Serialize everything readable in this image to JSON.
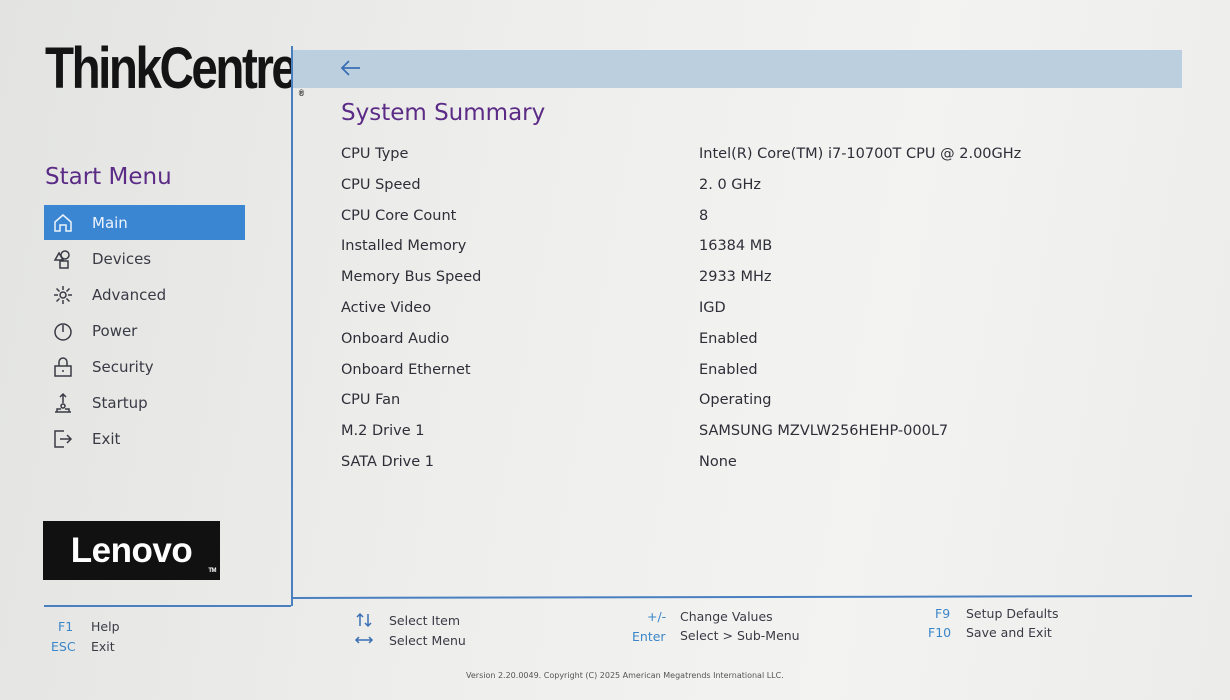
{
  "brand": {
    "name": "ThinkCentre",
    "trademark": "®"
  },
  "sidebar": {
    "title": "Start Menu",
    "items": [
      {
        "label": "Main",
        "icon": "home-icon",
        "active": true
      },
      {
        "label": "Devices",
        "icon": "devices-icon",
        "active": false
      },
      {
        "label": "Advanced",
        "icon": "advanced-icon",
        "active": false
      },
      {
        "label": "Power",
        "icon": "power-icon",
        "active": false
      },
      {
        "label": "Security",
        "icon": "lock-icon",
        "active": false
      },
      {
        "label": "Startup",
        "icon": "startup-icon",
        "active": false
      },
      {
        "label": "Exit",
        "icon": "exit-icon",
        "active": false
      }
    ]
  },
  "logo": {
    "name": "Lenovo",
    "trademark": "TM"
  },
  "main": {
    "title": "System Summary",
    "rows": [
      {
        "label": "CPU Type",
        "value": "Intel(R) Core(TM) i7-10700T CPU @ 2.00GHz"
      },
      {
        "label": "CPU Speed",
        "value": "2. 0 GHz"
      },
      {
        "label": "CPU Core Count",
        "value": "8"
      },
      {
        "label": "Installed Memory",
        "value": "16384 MB"
      },
      {
        "label": "Memory Bus Speed",
        "value": "2933 MHz"
      },
      {
        "label": "Active Video",
        "value": "IGD"
      },
      {
        "label": "Onboard Audio",
        "value": "Enabled"
      },
      {
        "label": "Onboard Ethernet",
        "value": "Enabled"
      },
      {
        "label": "CPU Fan",
        "value": "Operating"
      },
      {
        "label": "M.2 Drive 1",
        "value": "SAMSUNG MZVLW256HEHP-000L7"
      },
      {
        "label": "SATA Drive 1",
        "value": "None"
      }
    ]
  },
  "footer": {
    "f1_key": "F1",
    "f1_desc": "Help",
    "esc_key": "ESC",
    "esc_desc": "Exit",
    "select_item": "Select Item",
    "select_menu": "Select Menu",
    "plusminus_key": "+/-",
    "plusminus_desc": "Change Values",
    "enter_key": "Enter",
    "enter_desc": "Select > Sub-Menu",
    "f9_key": "F9",
    "f9_desc": "Setup Defaults",
    "f10_key": "F10",
    "f10_desc": "Save and Exit",
    "copyright": "Version 2.20.0049. Copyright (C) 2025 American Megatrends International LLC."
  },
  "colors": {
    "accent": "#3b86d3",
    "title": "#5b2b86",
    "divider": "#4a7fc0",
    "header_bar": "#bccfdf"
  }
}
